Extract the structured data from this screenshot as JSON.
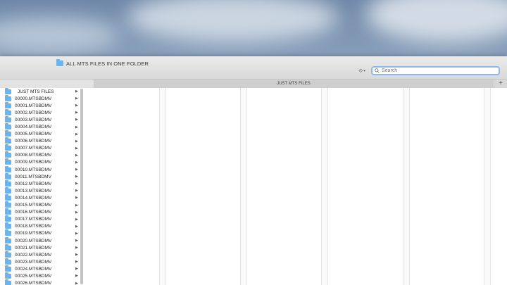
{
  "window": {
    "title": "ALL MTS FILES IN ONE FOLDER"
  },
  "search": {
    "placeholder": "Search"
  },
  "tabs": [
    {
      "label": ""
    },
    {
      "label": "JUST MTS FILES"
    }
  ],
  "tab_add_label": "+",
  "column1": {
    "header": "JUST MTS FILES",
    "items": [
      "00000.MTSBDMV",
      "00001.MTSBDMV",
      "00002.MTSBDMV",
      "00003.MTSBDMV",
      "00004.MTSBDMV",
      "00005.MTSBDMV",
      "00006.MTSBDMV",
      "00007.MTSBDMV",
      "00008.MTSBDMV",
      "00009.MTSBDMV",
      "00010.MTSBDMV",
      "00011.MTSBDMV",
      "00012.MTSBDMV",
      "00013.MTSBDMV",
      "00014.MTSBDMV",
      "00015.MTSBDMV",
      "00016.MTSBDMV",
      "00017.MTSBDMV",
      "00018.MTSBDMV",
      "00019.MTSBDMV",
      "00020.MTSBDMV",
      "00021.MTSBDMV",
      "00022.MTSBDMV",
      "00023.MTSBDMV",
      "00024.MTSBDMV",
      "00025.MTSBDMV",
      "00026.MTSBDMV"
    ]
  },
  "icons": {
    "folder": "folder-icon",
    "dropbox": "dropbox-icon",
    "search": "magnifier-icon",
    "chevron": "chevron-right-icon"
  },
  "colors": {
    "folder": "#6ab4ef",
    "search_focus": "#8db8ec"
  }
}
